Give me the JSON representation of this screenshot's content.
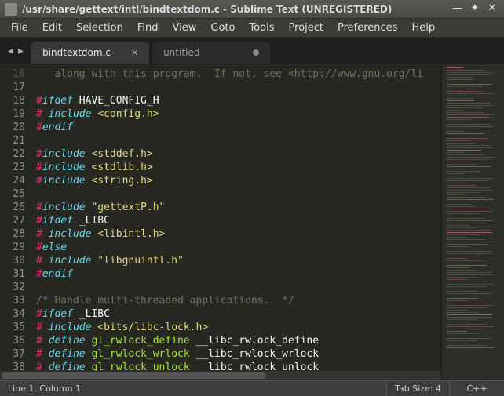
{
  "window": {
    "title": "/usr/share/gettext/intl/bindtextdom.c - Sublime Text (UNREGISTERED)"
  },
  "menu": {
    "items": [
      "File",
      "Edit",
      "Selection",
      "Find",
      "View",
      "Goto",
      "Tools",
      "Project",
      "Preferences",
      "Help"
    ]
  },
  "tabs": [
    {
      "label": "bindtextdom.c",
      "active": true,
      "dirty": false
    },
    {
      "label": "untitled",
      "active": false,
      "dirty": true
    }
  ],
  "status": {
    "position": "Line 1, Column 1",
    "tabsize": "Tab Size: 4",
    "syntax": "C++"
  },
  "code": {
    "first_line_no": 16,
    "lines": [
      [
        [
          "comment",
          "   along with this program.  If not, see <http://www.gnu.org/li"
        ]
      ],
      [],
      [
        [
          "prep",
          "#"
        ],
        [
          "prepw",
          "ifdef"
        ],
        [
          "ident",
          " HAVE_CONFIG_H"
        ]
      ],
      [
        [
          "prep",
          "# "
        ],
        [
          "prepw",
          "include"
        ],
        [
          "ident",
          " "
        ],
        [
          "string",
          "<config.h>"
        ]
      ],
      [
        [
          "prep",
          "#"
        ],
        [
          "prepw",
          "endif"
        ]
      ],
      [],
      [
        [
          "prep",
          "#"
        ],
        [
          "prepw",
          "include"
        ],
        [
          "ident",
          " "
        ],
        [
          "string",
          "<stddef.h>"
        ]
      ],
      [
        [
          "prep",
          "#"
        ],
        [
          "prepw",
          "include"
        ],
        [
          "ident",
          " "
        ],
        [
          "string",
          "<stdlib.h>"
        ]
      ],
      [
        [
          "prep",
          "#"
        ],
        [
          "prepw",
          "include"
        ],
        [
          "ident",
          " "
        ],
        [
          "string",
          "<string.h>"
        ]
      ],
      [],
      [
        [
          "prep",
          "#"
        ],
        [
          "prepw",
          "include"
        ],
        [
          "ident",
          " "
        ],
        [
          "string",
          "\"gettextP.h\""
        ]
      ],
      [
        [
          "prep",
          "#"
        ],
        [
          "prepw",
          "ifdef"
        ],
        [
          "ident",
          " _LIBC"
        ]
      ],
      [
        [
          "prep",
          "# "
        ],
        [
          "prepw",
          "include"
        ],
        [
          "ident",
          " "
        ],
        [
          "string",
          "<libintl.h>"
        ]
      ],
      [
        [
          "prep",
          "#"
        ],
        [
          "prepw",
          "else"
        ]
      ],
      [
        [
          "prep",
          "# "
        ],
        [
          "prepw",
          "include"
        ],
        [
          "ident",
          " "
        ],
        [
          "string",
          "\"libgnuintl.h\""
        ]
      ],
      [
        [
          "prep",
          "#"
        ],
        [
          "prepw",
          "endif"
        ]
      ],
      [],
      [
        [
          "comment",
          "/* Handle multi-threaded applications.  */"
        ]
      ],
      [
        [
          "prep",
          "#"
        ],
        [
          "prepw",
          "ifdef"
        ],
        [
          "ident",
          " _LIBC"
        ]
      ],
      [
        [
          "prep",
          "# "
        ],
        [
          "prepw",
          "include"
        ],
        [
          "ident",
          " "
        ],
        [
          "string",
          "<bits/libc-lock.h>"
        ]
      ],
      [
        [
          "prep",
          "# "
        ],
        [
          "prepw",
          "define"
        ],
        [
          "ident",
          " "
        ],
        [
          "define",
          "gl_rwlock_define"
        ],
        [
          "ident",
          " __libc_rwlock_define"
        ]
      ],
      [
        [
          "prep",
          "# "
        ],
        [
          "prepw",
          "define"
        ],
        [
          "ident",
          " "
        ],
        [
          "define",
          "gl_rwlock_wrlock"
        ],
        [
          "ident",
          " __libc_rwlock_wrlock"
        ]
      ],
      [
        [
          "prep",
          "# "
        ],
        [
          "prepw",
          "define"
        ],
        [
          "ident",
          " "
        ],
        [
          "define",
          "gl_rwlock_unlock"
        ],
        [
          "ident",
          " __libc_rwlock_unlock"
        ]
      ]
    ]
  }
}
